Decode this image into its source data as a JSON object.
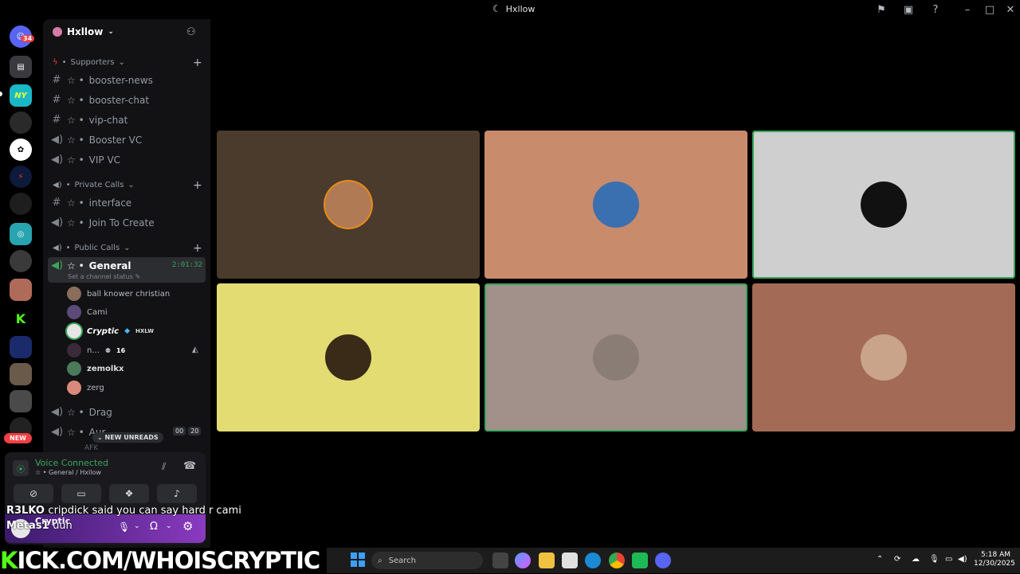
{
  "window": {
    "title": "Hxllow"
  },
  "rail": {
    "dm_badge": "34",
    "new_label": "NEW",
    "server_abbr_1": "NY",
    "server_abbr_2": "K"
  },
  "server": {
    "name": "Hxllow"
  },
  "categories": [
    {
      "label": "Supporters",
      "channels": [
        {
          "type": "text",
          "name": "booster-news"
        },
        {
          "type": "text",
          "name": "booster-chat"
        },
        {
          "type": "text",
          "name": "vip-chat"
        },
        {
          "type": "voice",
          "name": "Booster VC"
        },
        {
          "type": "voice",
          "name": "VIP VC"
        }
      ]
    },
    {
      "label": "Private Calls",
      "channels": [
        {
          "type": "text",
          "name": "interface"
        },
        {
          "type": "voice",
          "name": "Join To Create"
        }
      ]
    },
    {
      "label": "Public Calls",
      "channels": []
    }
  ],
  "general": {
    "name": "General",
    "timer": "2:01:32",
    "status_hint": "Set a channel status",
    "users": [
      {
        "name": "ball knower christian",
        "color": "#8a6d5a"
      },
      {
        "name": "Cami",
        "color": "#5b4a7a"
      },
      {
        "name": "Cryptic",
        "tag": "HXLW",
        "color": "#e6e6e6"
      },
      {
        "name": "n...",
        "badge": "16",
        "color": "#3b2a3a"
      },
      {
        "name": "zemolkx",
        "color": "#4a7a5a"
      },
      {
        "name": "zerg",
        "color": "#d98a7a"
      }
    ]
  },
  "other_voice": [
    {
      "name": "Drag"
    },
    {
      "name": "Aur",
      "count_a": "00",
      "count_b": "20"
    },
    {
      "name": "AFK"
    }
  ],
  "new_unreads": "NEW UNREADS",
  "voice_panel": {
    "status": "Voice Connected",
    "location": "General / Hxllow",
    "username": "Cryptic",
    "user_sub": "Metas1"
  },
  "tiles": [
    {
      "bg": "#4a3b2c",
      "avatar": "#b07a55",
      "speaking": false
    },
    {
      "bg": "#c88b6b",
      "avatar": "#3a6fb0",
      "speaking": false
    },
    {
      "bg": "#cfcfcf",
      "avatar": "#111111",
      "speaking": true
    },
    {
      "bg": "#e3dc73",
      "avatar": "#3a2a18",
      "speaking": false
    },
    {
      "bg": "#a1918a",
      "avatar": "#8a7d76",
      "speaking": true
    },
    {
      "bg": "#a36b55",
      "avatar": "#c9a48a",
      "speaking": false
    }
  ],
  "overlay": {
    "chat_user": "R3LKO",
    "chat_msg": "cripdick said you can say hard r cami",
    "chat_user2": "Metas1",
    "chat_msg2": "uuh",
    "banner": "ICK.COM/WHOISCRYPTIC",
    "banner_k": "K"
  },
  "taskbar": {
    "search_label": "Search",
    "time": "5:18 AM",
    "date": "12/30/2025"
  }
}
